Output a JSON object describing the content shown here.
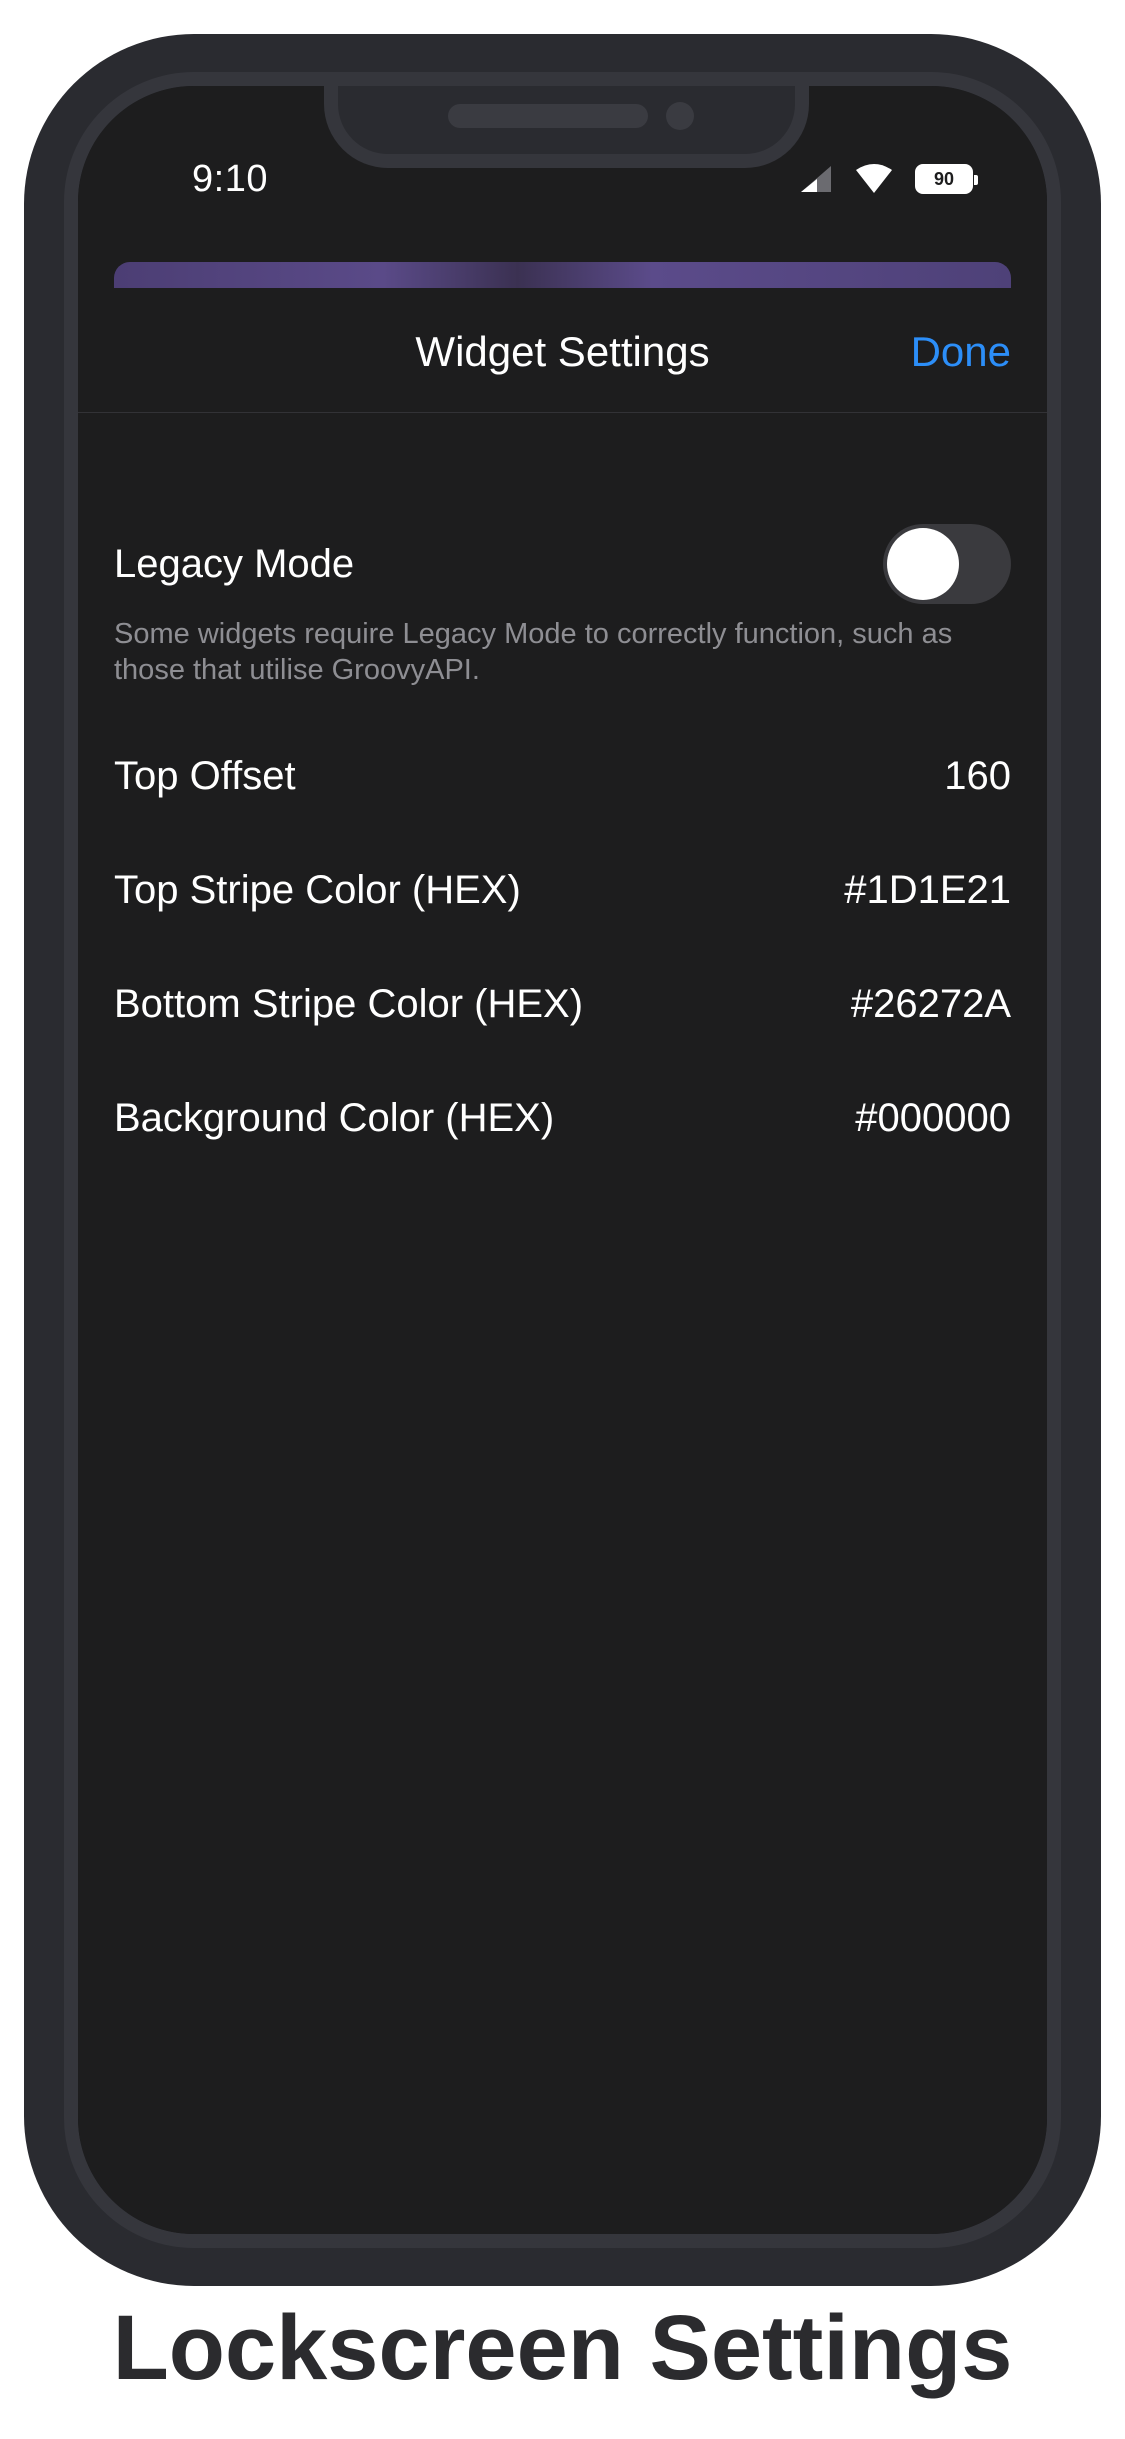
{
  "status_bar": {
    "time": "9:10",
    "battery_level": "90"
  },
  "nav": {
    "title": "Widget Settings",
    "done_label": "Done"
  },
  "legacy_mode": {
    "label": "Legacy Mode",
    "enabled": false,
    "description": "Some widgets require Legacy Mode to correctly function, such as those that utilise GroovyAPI."
  },
  "settings": [
    {
      "label": "Top Offset",
      "value": "160"
    },
    {
      "label": "Top Stripe Color (HEX)",
      "value": "#1D1E21"
    },
    {
      "label": "Bottom Stripe Color (HEX)",
      "value": "#26272A"
    },
    {
      "label": "Background Color (HEX)",
      "value": "#000000"
    }
  ],
  "caption": "Lockscreen Settings",
  "colors": {
    "accent": "#2C8EF8",
    "screen_background": "#1D1D1E",
    "device_frame": "#2A2B30"
  }
}
